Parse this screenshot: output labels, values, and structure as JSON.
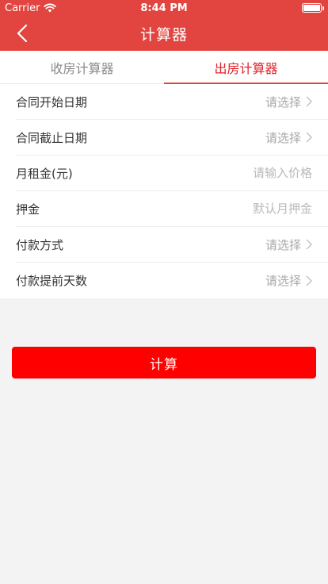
{
  "status_bar": {
    "carrier": "Carrier",
    "time": "8:44 PM",
    "icons": [
      "wifi-icon",
      "battery-icon"
    ]
  },
  "nav": {
    "title": "计算器",
    "back_icon": "chevron-left-icon"
  },
  "tabs": [
    {
      "label": "收房计算器",
      "active": false
    },
    {
      "label": "出房计算器",
      "active": true
    }
  ],
  "form": {
    "start_date": {
      "label": "合同开始日期",
      "value": "请选择"
    },
    "end_date": {
      "label": "合同截止日期",
      "value": "请选择"
    },
    "monthly_rent": {
      "label": "月租金(元)",
      "placeholder": "请输入价格"
    },
    "deposit": {
      "label": "押金",
      "placeholder": "默认月押金"
    },
    "payment_method": {
      "label": "付款方式",
      "value": "请选择"
    },
    "advance_days": {
      "label": "付款提前天数",
      "value": "请选择"
    }
  },
  "actions": {
    "calculate_label": "计算"
  },
  "colors": {
    "header_bg": "#e2453f",
    "active_tab": "#e2202a",
    "button_bg": "#ff0000",
    "page_bg": "#f3f3f3"
  }
}
